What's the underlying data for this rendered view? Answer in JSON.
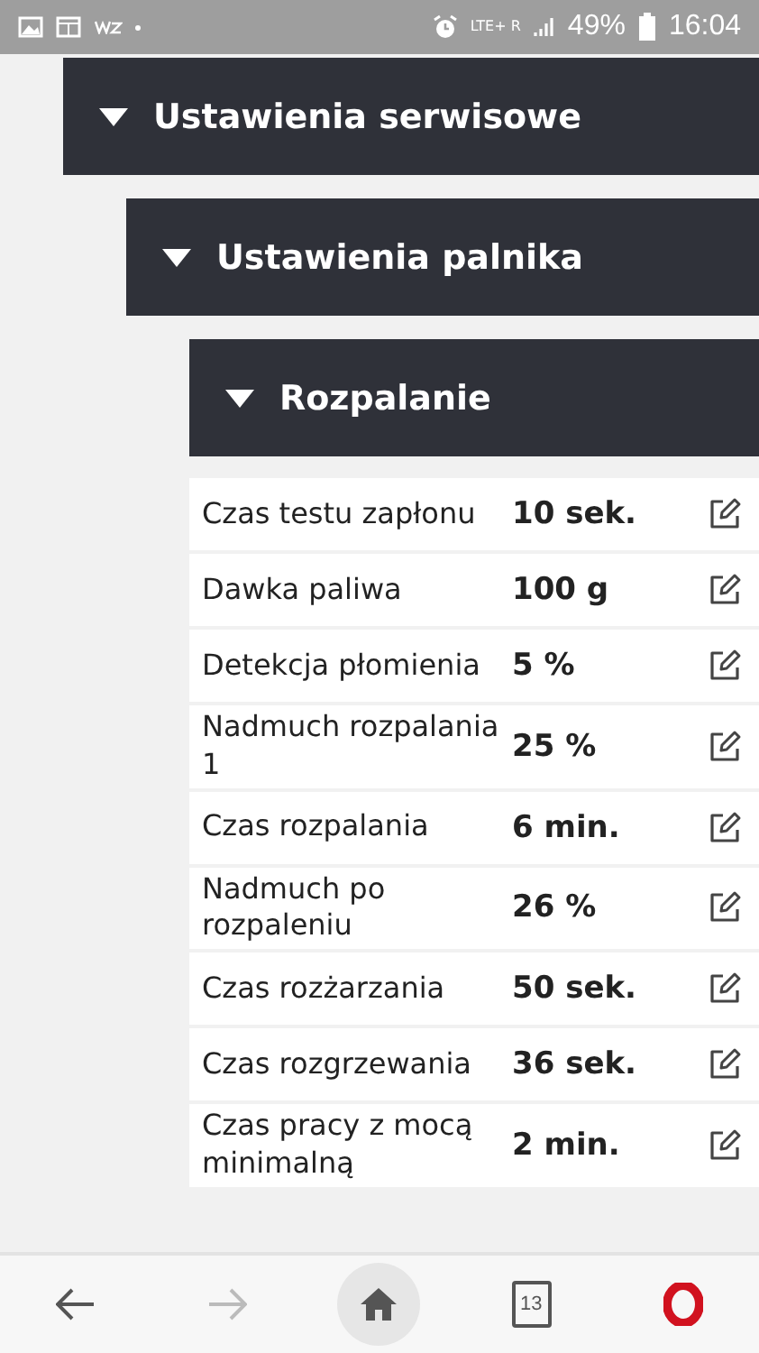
{
  "status_bar": {
    "network": "LTE+ R",
    "battery": "49%",
    "time": "16:04"
  },
  "sections": [
    {
      "title": "Ustawienia serwisowe",
      "expanded": true,
      "children": [
        {
          "title": "Ustawienia palnika",
          "expanded": true,
          "children": [
            {
              "title": "Rozpalanie",
              "expanded": true,
              "rows": [
                {
                  "label": "Czas testu zapłonu",
                  "value": "10 sek."
                },
                {
                  "label": "Dawka paliwa",
                  "value": "100 g"
                },
                {
                  "label": "Detekcja płomienia",
                  "value": "5 %"
                },
                {
                  "label": "Nadmuch rozpalania 1",
                  "value": "25 %"
                },
                {
                  "label": "Czas rozpalania",
                  "value": "6 min."
                },
                {
                  "label": "Nadmuch po rozpaleniu",
                  "value": "26 %"
                },
                {
                  "label": "Czas rozżarzania",
                  "value": "50 sek."
                },
                {
                  "label": "Czas rozgrzewania",
                  "value": "36 sek."
                },
                {
                  "label": "Czas pracy z mocą minimalną",
                  "value": "2 min."
                }
              ]
            }
          ]
        }
      ]
    }
  ],
  "nav": [
    {
      "kind": "back",
      "disabled": false,
      "selected": false
    },
    {
      "kind": "forward",
      "disabled": true,
      "selected": false
    },
    {
      "kind": "home",
      "disabled": false,
      "selected": true
    },
    {
      "kind": "tabs",
      "count": "13",
      "disabled": false,
      "selected": false
    },
    {
      "kind": "opera",
      "disabled": false,
      "selected": false
    }
  ]
}
